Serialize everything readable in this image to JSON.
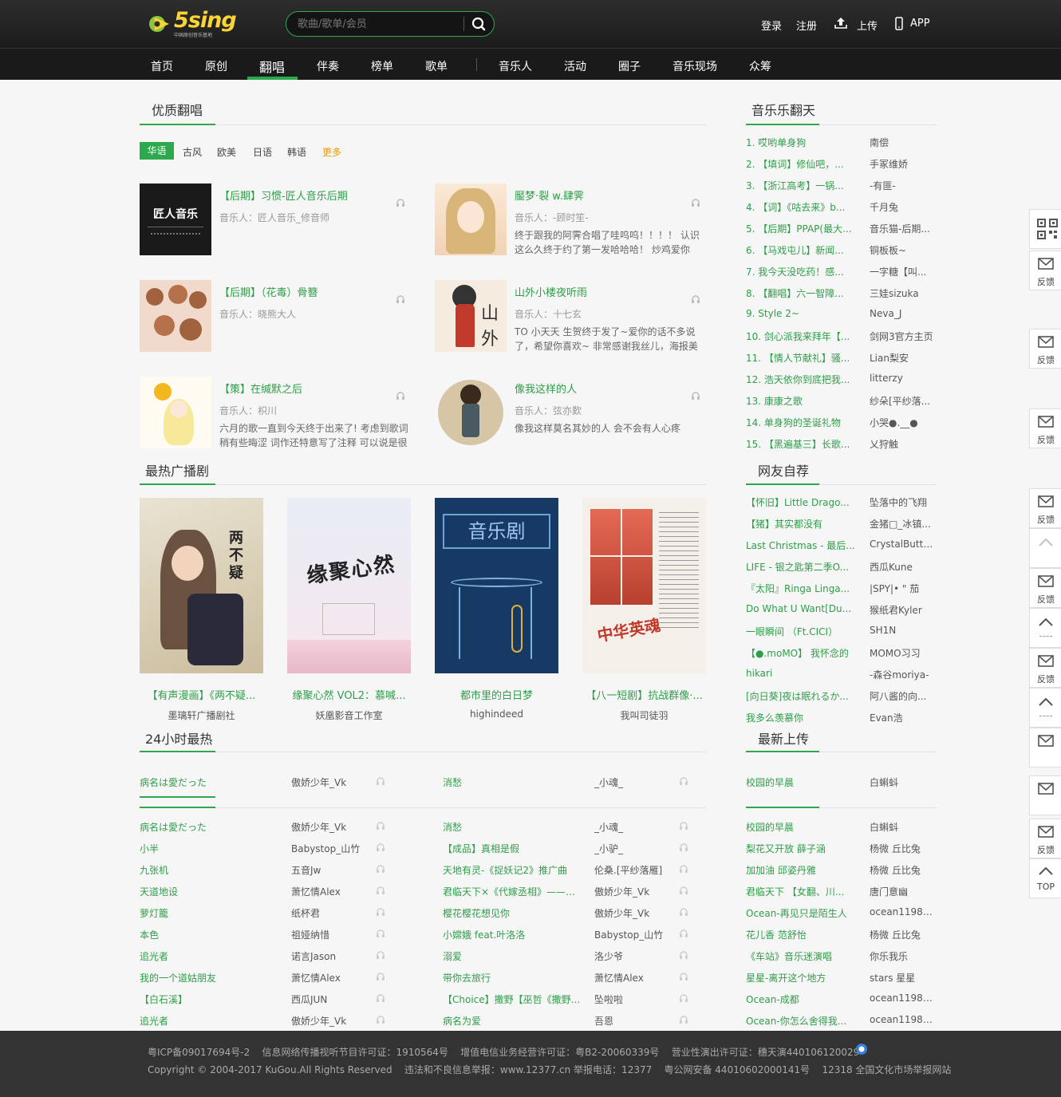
{
  "header": {
    "logo_text": "5sing",
    "logo_sub": "中国原创音乐基地",
    "search_placeholder": "歌曲/歌单/会员",
    "login": "登录",
    "register": "注册",
    "upload": "上传",
    "app": "APP"
  },
  "nav": {
    "items": [
      "首页",
      "原创",
      "翻唱",
      "伴奏",
      "榜单",
      "歌单",
      "音乐人",
      "活动",
      "圈子",
      "音乐现场",
      "众筹"
    ],
    "active_index": 2
  },
  "quality_covers": {
    "title": "优质翻唱",
    "tabs": [
      "华语",
      "古风",
      "欧美",
      "日语",
      "韩语",
      "更多"
    ],
    "active_tab": "华语",
    "items": [
      {
        "title": "【后期】习惯-匠人音乐后期",
        "artist": "音乐人：匠人音乐_修音师",
        "desc": "",
        "cover_label": "匠人音乐"
      },
      {
        "title": "靨梦·裂 w.肆霁",
        "artist": "音乐人：-顾时笙-",
        "desc": "终于跟我的阿霁合唱了哇呜呜！！！！ 认识这么久终于约了第一发哈哈哈！ 炒鸡爱你",
        "cover_label": ""
      },
      {
        "title": "【后期】（花毒）骨簪",
        "artist": "音乐人：晓熊大人",
        "desc": "",
        "cover_label": ""
      },
      {
        "title": "山外小楼夜听雨",
        "artist": "音乐人：十七玄",
        "desc": "TO 小天天 生贺终于发了~爱你的话不多说了，希望你喜欢~ 非常感谢我丝儿，海报美",
        "cover_label": "山外小楼"
      },
      {
        "title": "【策】在缄默之后",
        "artist": "音乐人：枳川",
        "desc": "六月的歌一直到今天终于出来了! 考虑到歌词稍有些晦涩 词作还特意写了注释 可以说是很",
        "cover_label": ""
      },
      {
        "title": "像我这样的人",
        "artist": "音乐人：弦亦歎",
        "desc": "像我这样莫名其妙的人 会不会有人心疼",
        "cover_label": ""
      }
    ]
  },
  "radio_drama": {
    "title": "最热广播剧",
    "items": [
      {
        "title": "【有声漫画】《两不疑...",
        "author": "墨璃轩广播剧社",
        "cover_label": "两不疑"
      },
      {
        "title": "缘聚心然 VOL2：慕喊...",
        "author": "妖凰影音工作室",
        "cover_label": "缘聚心然"
      },
      {
        "title": "都市里的白日梦",
        "author": "highindeed",
        "cover_label": "音乐剧"
      },
      {
        "title": "【八一短剧】抗战群像·...",
        "author": "我叫司徒羽",
        "cover_label": "中华英魂"
      }
    ]
  },
  "hot24": {
    "title": "24小时最热",
    "ghost_row": [
      {
        "title": "病名は愛だった",
        "artist": "傲娇少年_Vk"
      },
      {
        "title": "消愁",
        "artist": "_小魂_"
      }
    ],
    "left": [
      {
        "title": "病名は愛だった",
        "artist": "傲娇少年_Vk"
      },
      {
        "title": "小半",
        "artist": "Babystop_山竹"
      },
      {
        "title": "九张机",
        "artist": "五音Jw"
      },
      {
        "title": "天道地设",
        "artist": "萧忆情Alex"
      },
      {
        "title": "萝灯籠",
        "artist": "纸杯君"
      },
      {
        "title": "本色",
        "artist": "祖娅纳惜"
      },
      {
        "title": "追光者",
        "artist": "诺言Jason"
      },
      {
        "title": "我的一个道姑朋友",
        "artist": "萧忆情Alex"
      },
      {
        "title": "【白石溪】",
        "artist": "西瓜JUN"
      },
      {
        "title": "追光者",
        "artist": "傲娇少年_Vk"
      }
    ],
    "right": [
      {
        "title": "消愁",
        "artist": "_小魂_"
      },
      {
        "title": "【成品】真相是假",
        "artist": "_小驴_"
      },
      {
        "title": "天地有灵-《捉妖记2》推广曲",
        "artist": "伦桑.[平纱落雁]"
      },
      {
        "title": "君临天下×《代嫁丞相》——雌...",
        "artist": "傲娇少年_Vk"
      },
      {
        "title": "樱花樱花想见你",
        "artist": "傲娇少年_Vk"
      },
      {
        "title": "小嫦娥 feat.叶洛洛",
        "artist": "Babystop_山竹"
      },
      {
        "title": "溺爱",
        "artist": "洛少爷"
      },
      {
        "title": "带你去旅行",
        "artist": "萧忆情Alex"
      },
      {
        "title": "【Choice】撒野【巫哲《撒野...",
        "artist": "坠啦啦"
      },
      {
        "title": "病名为爱",
        "artist": "吾恩"
      }
    ]
  },
  "rank": {
    "title": "音乐乐翻天",
    "items": [
      {
        "title": "1. 哎哟单身狗",
        "artist": "南偿"
      },
      {
        "title": "2. 【填词】修仙吧，...",
        "artist": "手冢维娇"
      },
      {
        "title": "3. 【浙江高考】一锅...",
        "artist": "-有匪-"
      },
      {
        "title": "4. 【词】《咕去来》b...",
        "artist": "千月兔"
      },
      {
        "title": "5. 【后期】PPAP(最大...",
        "artist": "音乐猫-后期..."
      },
      {
        "title": "6. 【马戏屯儿】新闻...",
        "artist": "铜板板~"
      },
      {
        "title": "7. 我今天没吃药！感...",
        "artist": "一字糖【叫..."
      },
      {
        "title": "8. 【翻唱】六一智障...",
        "artist": "三娃sizuka"
      },
      {
        "title": "9. Style 2~",
        "artist": "Neva_J"
      },
      {
        "title": "10. 剑心派我来拜年【...",
        "artist": "剑网3官方主页"
      },
      {
        "title": "11. 【情人节献礼】骚...",
        "artist": "Lian梨安"
      },
      {
        "title": "12. 浩天依你到底把我...",
        "artist": "litterzy"
      },
      {
        "title": "13. 康康之歌",
        "artist": "纱朵[平纱落..."
      },
      {
        "title": "14. 单身狗的圣诞礼物",
        "artist": "小哭●.__●"
      },
      {
        "title": "15. 【黑遍基三】长歌...",
        "artist": "乂狩触"
      }
    ]
  },
  "recommend": {
    "title": "网友自荐",
    "items": [
      {
        "title": "【怀旧】Little Drago...",
        "artist": "坠落中的飞翔"
      },
      {
        "title": "【猪】其实都没有",
        "artist": "金猪□_冰镇..."
      },
      {
        "title": "Last Christmas - 最后...",
        "artist": "CrystalButte..."
      },
      {
        "title": "LIFE - 银之匙第二季O...",
        "artist": "西瓜Kune"
      },
      {
        "title": "『太阳』Ringa Linga...",
        "artist": "|SPY|• \" 茄"
      },
      {
        "title": "Do What U Want[Du...",
        "artist": "猴纸君Kyler"
      },
      {
        "title": "一眼瞬间 （Ft.CICI）",
        "artist": "SH1N"
      },
      {
        "title": "【●.moMO】 我怀念的",
        "artist": "MOMO习习"
      },
      {
        "title": "hikari",
        "artist": "-森谷moriya-"
      },
      {
        "title": "[向日葵]夜は眠れるか...",
        "artist": "阿八酱的向..."
      },
      {
        "title": "我多么羡慕你",
        "artist": "Evan浩"
      }
    ]
  },
  "newest": {
    "title": "最新上传",
    "ghost_row": {
      "title": "校园的早晨",
      "artist": "白蝌蚪"
    },
    "items": [
      {
        "title": "校园的早晨",
        "artist": "白蝌蚪"
      },
      {
        "title": "梨花又开放 薛子涵",
        "artist": "杨微 丘比兔"
      },
      {
        "title": "加加油 邱姿丹雅",
        "artist": "杨微 丘比兔"
      },
      {
        "title": "君临天下 【女翻、川...",
        "artist": "唐门意幽"
      },
      {
        "title": "Ocean-再见只是陌生人",
        "artist": "ocean11981..."
      },
      {
        "title": "花儿香 范舒怡",
        "artist": "杨微 丘比兔"
      },
      {
        "title": "《车站》音乐迷演唱",
        "artist": "你乐我乐"
      },
      {
        "title": "星星-离开这个地方",
        "artist": "stars 星星"
      },
      {
        "title": "Ocean-成都",
        "artist": "ocean11981..."
      },
      {
        "title": "Ocean-你怎么舍得我...",
        "artist": "ocean11981..."
      }
    ]
  },
  "sidebar": {
    "feedback": "反馈",
    "top": "TOP"
  },
  "footer": {
    "line1": "粤ICP备09017694号-2    信息网络传播视听节目许可证：1910564号    增值电信业务经营许可证：粤B2-20060339号    营业性演出许可证：穗天演440106120029",
    "line2": "Copyright © 2004-2017 KuGou.All Rights Reserved    违法和不良信息举报：www.12377.cn 举报电话：12377    粤公网安备 44010602000141号    12318 全国文化市场举报网站"
  },
  "colors": {
    "accent": "#2ea84d",
    "header_bg": "#1f1f1f",
    "logo_yellow": "#fcd535",
    "footer_bg": "#333333"
  }
}
